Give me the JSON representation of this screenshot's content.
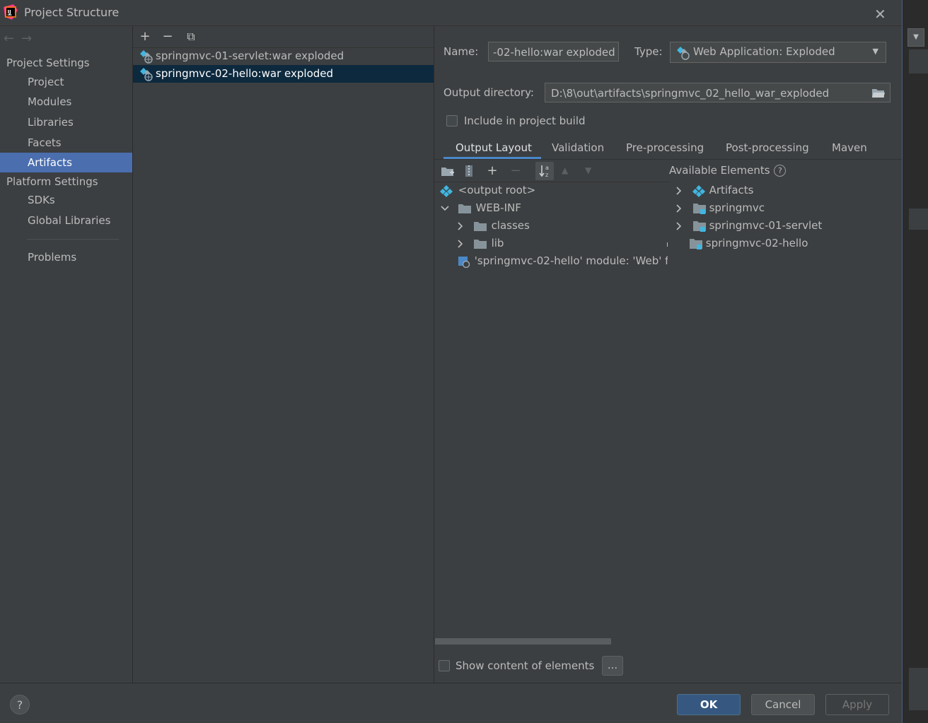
{
  "window": {
    "title": "Project Structure",
    "close_glyph": "✕"
  },
  "sidebar": {
    "nav_back": "←",
    "nav_forward": "→",
    "project_settings_label": "Project Settings",
    "project_items": [
      {
        "label": "Project",
        "selected": false
      },
      {
        "label": "Modules",
        "selected": false
      },
      {
        "label": "Libraries",
        "selected": false
      },
      {
        "label": "Facets",
        "selected": false
      },
      {
        "label": "Artifacts",
        "selected": true
      }
    ],
    "platform_settings_label": "Platform Settings",
    "platform_items": [
      {
        "label": "SDKs"
      },
      {
        "label": "Global Libraries"
      }
    ],
    "problems_label": "Problems"
  },
  "artifacts_list": {
    "toolbar": {
      "add": "+",
      "remove": "−",
      "copy": "⧉"
    },
    "items": [
      {
        "label": "springmvc-01-servlet:war exploded",
        "selected": false
      },
      {
        "label": "springmvc-02-hello:war exploded",
        "selected": true
      }
    ]
  },
  "artifact_form": {
    "name_label": "Name:",
    "name_value": "-02-hello:war exploded",
    "type_label": "Type:",
    "type_value": "Web Application: Exploded",
    "output_dir_label": "Output directory:",
    "output_dir_value": "D:\\8\\out\\artifacts\\springmvc_02_hello_war_exploded",
    "include_in_build_label": "Include in project build",
    "include_in_build_checked": false
  },
  "tabs": [
    {
      "label": "Output Layout",
      "selected": true
    },
    {
      "label": "Validation",
      "selected": false
    },
    {
      "label": "Pre-processing",
      "selected": false
    },
    {
      "label": "Post-processing",
      "selected": false
    },
    {
      "label": "Maven",
      "selected": false
    }
  ],
  "output_layout": {
    "tree": [
      {
        "label": "<output root>",
        "level": 0,
        "expanded": null,
        "icon": "artifact-root-icon"
      },
      {
        "label": "WEB-INF",
        "level": 0,
        "expanded": true,
        "icon": "folder-icon"
      },
      {
        "label": "classes",
        "level": 1,
        "expanded": false,
        "icon": "folder-icon"
      },
      {
        "label": "lib",
        "level": 1,
        "expanded": false,
        "icon": "folder-icon"
      },
      {
        "label": "'springmvc-02-hello' module: 'Web' fa",
        "level": 1,
        "expanded": null,
        "icon": "web-facet-icon"
      }
    ]
  },
  "available_elements": {
    "title": "Available Elements",
    "help_glyph": "?",
    "items": [
      {
        "label": "Artifacts",
        "expandable": true,
        "icon": "artifacts-icon"
      },
      {
        "label": "springmvc",
        "expandable": true,
        "icon": "module-folder-icon"
      },
      {
        "label": "springmvc-01-servlet",
        "expandable": true,
        "icon": "module-folder-icon"
      },
      {
        "label": "springmvc-02-hello",
        "expandable": false,
        "icon": "module-folder-icon"
      }
    ]
  },
  "footer": {
    "show_content_label": "Show content of elements",
    "show_content_checked": false,
    "dots_label": "...",
    "help_label": "?",
    "ok_label": "OK",
    "cancel_label": "Cancel",
    "apply_label": "Apply"
  },
  "colors": {
    "background": "#3c3f41",
    "selection": "#4b6eaf",
    "list_selection": "#0d293e",
    "accent": "#4a88c7",
    "ok_button": "#365880"
  }
}
